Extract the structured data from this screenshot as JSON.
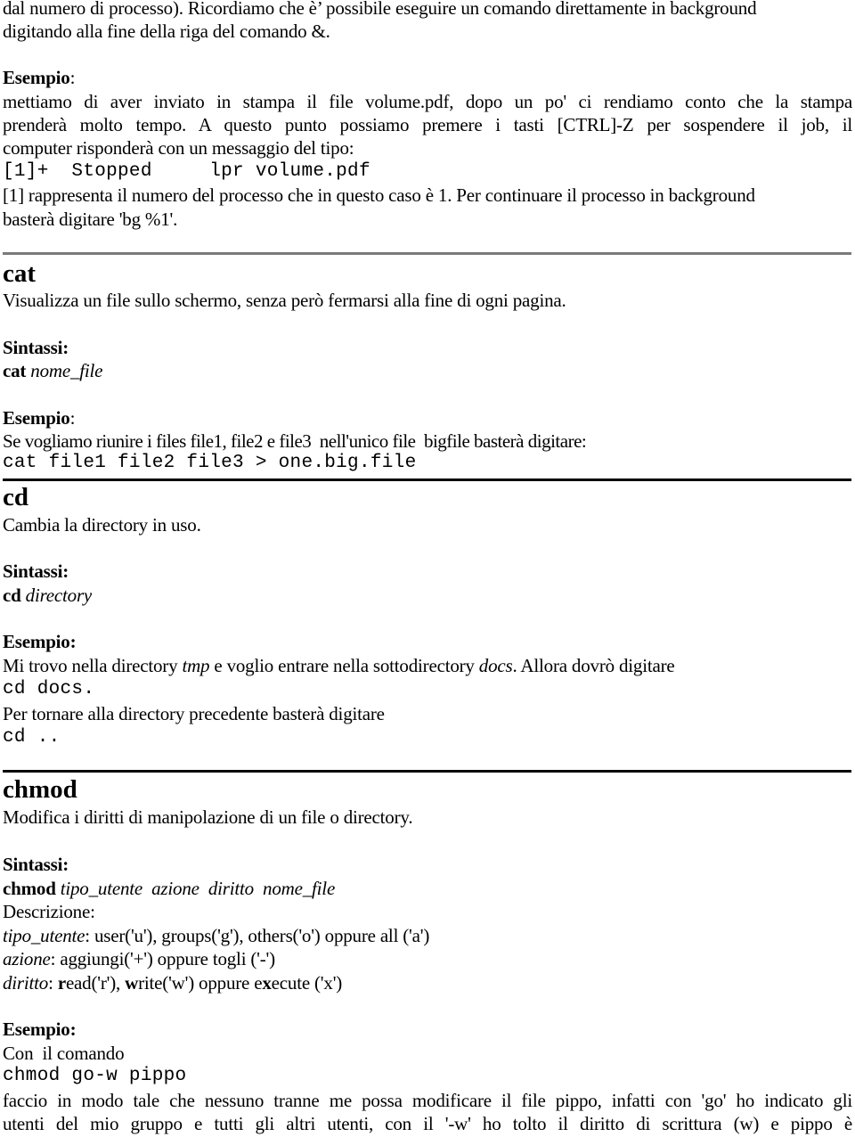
{
  "intro": {
    "line1": "dal numero di processo). Ricordiamo che è’ possibile eseguire un comando direttamente in background",
    "line2": "digitando alla fine della riga del comando &.",
    "example_label": "Esempio",
    "example_colon": ":",
    "ex_line1": "mettiamo di aver inviato in stampa il file volume.pdf, dopo un po' ci rendiamo conto che la stampa",
    "ex_line2": "prenderà molto tempo. A questo punto possiamo premere i tasti [CTRL]-Z per sospendere il job, il",
    "ex_line3": "computer risponderà con un messaggio del tipo:",
    "code": "[1]+  Stopped     lpr volume.pdf",
    "ex_line4": "[1] rappresenta il numero del processo che in questo caso è 1. Per continuare il processo in background",
    "ex_line5": "basterà digitare 'bg %1'."
  },
  "commands": {
    "cat": {
      "title": "cat",
      "description": "Visualizza un file sullo schermo, senza però fermarsi alla fine di ogni pagina.",
      "syntax_label": "Sintassi:",
      "syntax_cmd": "cat",
      "syntax_args": " nome_file",
      "example_label": "Esempio",
      "example_colon": ":",
      "example_text": "Se vogliamo riunire i files file1, file2 e file3  nell'unico file  bigfile basterà digitare:",
      "example_code": "cat file1 file2 file3 > one.big.file"
    },
    "cd": {
      "title": "cd",
      "description": "Cambia la directory in uso.",
      "syntax_label": "Sintassi:",
      "syntax_cmd": "cd",
      "syntax_args": " directory",
      "example_label": "Esempio:",
      "example_text_a": "Mi trovo nella directory ",
      "example_text_tmp": "tmp",
      "example_text_b": " e voglio entrare nella sottodirectory ",
      "example_text_docs": "docs",
      "example_text_c": ". Allora dovrò digitare",
      "example_code1": "cd docs.",
      "example_text2": "Per tornare alla directory precedente basterà digitare",
      "example_code2": "cd .."
    },
    "chmod": {
      "title": "chmod",
      "description": "Modifica i diritti di manipolazione di un file o directory.",
      "syntax_label": "Sintassi:",
      "syntax_cmd": "chmod",
      "syntax_args": " tipo_utente  azione  diritto  nome_file",
      "description_label": "Descrizione:",
      "desc_tipo_term": "tipo_utente",
      "desc_tipo_text": ": user('u'), groups('g'), others('o') oppure all ('a')",
      "desc_azione_term": "azione",
      "desc_azione_text": ": aggiungi('+') oppure togli ('-')",
      "desc_diritto_term": "diritto",
      "desc_diritto_sep": ": ",
      "desc_r_bold": "r",
      "desc_r_rest": "ead('r'), ",
      "desc_w_bold": "w",
      "desc_w_rest": "rite('w') oppure e",
      "desc_x_bold": "x",
      "desc_x_rest": "ecute ('x')",
      "example_label": "Esempio:",
      "example_text1": "Con  il comando",
      "example_code": "chmod go-w pippo",
      "example_text2": "faccio in modo tale che nessuno tranne me possa modificare il file pippo, infatti con 'go' ho indicato  gli",
      "example_text3": "utenti del mio gruppo e tutti gli altri utenti, con il '-w' ho tolto il diritto di scrittura (w) e pippo è"
    }
  }
}
